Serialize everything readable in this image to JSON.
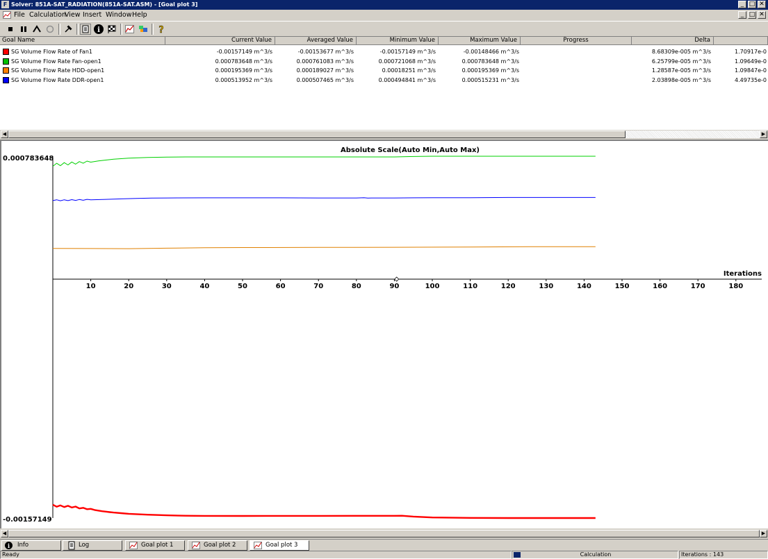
{
  "window": {
    "title": "Solver: 851A-SAT_RADIATION(851A-SAT.ASM) - [Goal plot 3]",
    "app_icon": "F",
    "controls": [
      "_",
      "□",
      "✕"
    ]
  },
  "menu": {
    "items": [
      "File",
      "Calculation",
      "View",
      "Insert",
      "Window",
      "Help"
    ]
  },
  "toolbar": {
    "icons": [
      "stop-icon",
      "pause-icon",
      "step-icon",
      "refresh-icon",
      "pin-icon",
      "document-icon",
      "info-icon",
      "flag-icon",
      "goal-plot-icon",
      "cut-plot-icon",
      "help-icon"
    ]
  },
  "goals_table": {
    "columns": [
      "Goal Name",
      "Current Value",
      "Averaged Value",
      "Minimum Value",
      "Maximum Value",
      "Progress",
      "Delta",
      ""
    ],
    "rows": [
      {
        "color": "#ff0000",
        "name": "SG Volume Flow Rate of Fan1",
        "current": "-0.00157149 m^3/s",
        "averaged": "-0.00153677 m^3/s",
        "minimum": "-0.00157149 m^3/s",
        "maximum": "-0.00148466 m^3/s",
        "delta": "8.68309e-005 m^3/s",
        "extra": "1.70917e-0"
      },
      {
        "color": "#00c000",
        "name": "SG Volume Flow Rate Fan-open1",
        "current": "0.000783648 m^3/s",
        "averaged": "0.000761083 m^3/s",
        "minimum": "0.000721068 m^3/s",
        "maximum": "0.000783648 m^3/s",
        "delta": "6.25799e-005 m^3/s",
        "extra": "1.09649e-0"
      },
      {
        "color": "#ff8000",
        "name": "SG Volume Flow Rate HDD-open1",
        "current": "0.000195369 m^3/s",
        "averaged": "0.000189027 m^3/s",
        "minimum": "0.00018251 m^3/s",
        "maximum": "0.000195369 m^3/s",
        "delta": "1.28587e-005 m^3/s",
        "extra": "1.09847e-0"
      },
      {
        "color": "#0000ff",
        "name": "SG Volume Flow Rate DDR-open1",
        "current": "0.000513952 m^3/s",
        "averaged": "0.000507465 m^3/s",
        "minimum": "0.000494841 m^3/s",
        "maximum": "0.000515231 m^3/s",
        "delta": "2.03898e-005 m^3/s",
        "extra": "4.49735e-0"
      }
    ]
  },
  "chart_data": {
    "type": "line",
    "title": "Absolute Scale(Auto Min,Auto Max)",
    "xlabel": "Iterations",
    "ylabel": "",
    "xlim": [
      0,
      185
    ],
    "ylim": [
      -0.00157149,
      0.000783648
    ],
    "y_tick_labels": [
      "0.000783648",
      "-0.00157149"
    ],
    "x_ticks": [
      10,
      20,
      30,
      40,
      50,
      60,
      70,
      80,
      90,
      100,
      110,
      120,
      130,
      140,
      150,
      160,
      170,
      180
    ],
    "grid": false,
    "series": [
      {
        "color": "#00d000",
        "width": 1,
        "x": [
          0,
          1,
          2,
          3,
          4,
          5,
          6,
          7,
          8,
          9,
          10,
          12,
          14,
          16,
          18,
          20,
          25,
          30,
          35,
          40,
          50,
          60,
          70,
          80,
          90,
          92,
          95,
          100,
          110,
          120,
          130,
          143
        ],
        "y": [
          0.000718,
          0.000738,
          0.000722,
          0.000742,
          0.000727,
          0.000746,
          0.000732,
          0.000749,
          0.000738,
          0.000752,
          0.000745,
          0.000753,
          0.000759,
          0.000764,
          0.000768,
          0.000771,
          0.000776,
          0.000778,
          0.000779,
          0.000779,
          0.000779,
          0.000779,
          0.000779,
          0.000779,
          0.000779,
          0.00078,
          0.000782,
          0.000783648,
          0.000783648,
          0.000783648,
          0.000783648,
          0.000783648
        ]
      },
      {
        "color": "#0000ff",
        "width": 1,
        "x": [
          0,
          1,
          2,
          3,
          4,
          5,
          6,
          7,
          8,
          9,
          10,
          14,
          18,
          22,
          26,
          30,
          40,
          50,
          60,
          70,
          80,
          82,
          83,
          84,
          90,
          95,
          100,
          110,
          120,
          130,
          143
        ],
        "y": [
          0.000495,
          0.0005,
          0.000494,
          0.0005,
          0.000495,
          0.000501,
          0.000496,
          0.000502,
          0.000497,
          0.000503,
          0.0005,
          0.000503,
          0.000506,
          0.000509,
          0.000511,
          0.000512,
          0.000513,
          0.000513,
          0.000513,
          0.000512,
          0.000512,
          0.000514,
          0.000511,
          0.000512,
          0.000512,
          0.000513,
          0.000514,
          0.000514,
          0.000515,
          0.000515,
          0.000515
        ]
      },
      {
        "color": "#e08000",
        "width": 1,
        "x": [
          0,
          10,
          20,
          30,
          40,
          50,
          70,
          90,
          110,
          130,
          143
        ],
        "y": [
          0.000184,
          0.000183,
          0.000182,
          0.000185,
          0.000188,
          0.000189,
          0.00019,
          0.000191,
          0.000193,
          0.000195,
          0.000195
        ]
      },
      {
        "color": "#ff0000",
        "width": 2.4,
        "x": [
          0,
          1,
          2,
          3,
          4,
          5,
          6,
          7,
          8,
          9,
          10,
          11,
          12,
          13,
          14,
          15,
          16,
          18,
          20,
          25,
          30,
          35,
          40,
          50,
          60,
          70,
          80,
          90,
          92,
          95,
          100,
          110,
          120,
          130,
          143
        ],
        "y": [
          -0.00148466,
          -0.001498,
          -0.001489,
          -0.0015,
          -0.001492,
          -0.001503,
          -0.001497,
          -0.001509,
          -0.001505,
          -0.001514,
          -0.001512,
          -0.001519,
          -0.001523,
          -0.001527,
          -0.00153,
          -0.001533,
          -0.001536,
          -0.00154,
          -0.001544,
          -0.00155,
          -0.001554,
          -0.0015565,
          -0.0015575,
          -0.001558,
          -0.0015575,
          -0.0015573,
          -0.0015572,
          -0.001557,
          -0.0015565,
          -0.001562,
          -0.001568,
          -0.0015708,
          -0.00157149,
          -0.00157149,
          -0.00157149
        ]
      }
    ]
  },
  "tabs": [
    {
      "icon": "info-icon",
      "label": "Info"
    },
    {
      "icon": "log-icon",
      "label": "Log"
    },
    {
      "icon": "goal-plot-icon",
      "label": "Goal plot 1"
    },
    {
      "icon": "goal-plot-icon",
      "label": "Goal plot 2"
    },
    {
      "icon": "goal-plot-icon",
      "label": "Goal plot 3"
    }
  ],
  "status": {
    "ready": "Ready",
    "calculation": "Calculation",
    "iterations": "Iterations : 143"
  }
}
